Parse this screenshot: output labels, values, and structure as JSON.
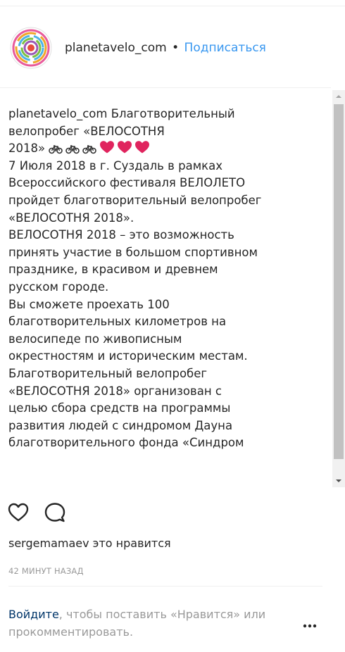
{
  "header": {
    "username": "planetavelo_com",
    "separator": "•",
    "follow_label": "Подписаться"
  },
  "caption": {
    "username": "planetavelo_com",
    "lines": [
      "Благотворительный",
      "велопробег «ВЕЛОСОТНЯ",
      "2018»",
      "7 Июля 2018 в г. Суздаль в рамках",
      "Всероссийского  фестиваля ВЕЛОЛЕТО",
      "пройдет благотворительный велопробег",
      "«ВЕЛОСОТНЯ 2018».",
      "ВЕЛОСОТНЯ 2018 – это возможность",
      "принять участие в большом спортивном",
      "празднике, в  красивом и древнем",
      "русском городе.",
      "Вы сможете проехать 100",
      "благотворительных километров на",
      "велосипеде по живописным",
      "окрестностям и историческим местам.",
      "Благотворительный велопробег",
      "«ВЕЛОСОТНЯ 2018»  организован с",
      "целью сбора средств на программы",
      "развития людей с синдромом Дауна",
      "благотворительного фонда «Синдром"
    ],
    "emojis": [
      "bicycle",
      "bicycle",
      "bicycle",
      "red-heart",
      "red-heart",
      "red-heart"
    ]
  },
  "likes": {
    "user": "sergemamaev",
    "suffix": " это нравится"
  },
  "timestamp": "42 МИНУТ НАЗАД",
  "login_prompt": {
    "link": "Войдите",
    "text": ", чтобы поставить «Нравится» или прокомментировать."
  },
  "colors": {
    "link_blue": "#3897f0",
    "login_link": "#003569",
    "heart_red": "#e0245e",
    "muted": "#999999"
  },
  "icons": {
    "like": "heart-outline-icon",
    "comment": "comment-bubble-icon",
    "more": "more-options-icon"
  }
}
